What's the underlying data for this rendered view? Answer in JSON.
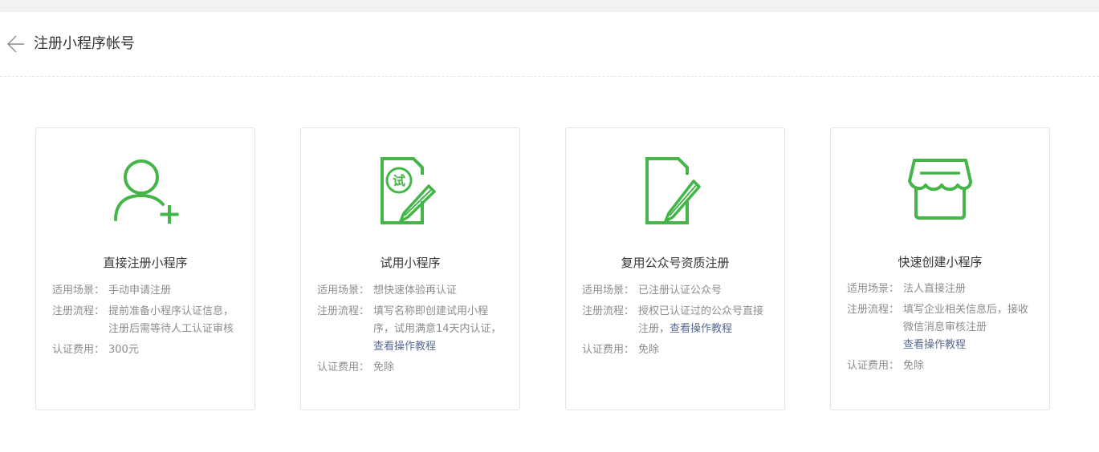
{
  "header": {
    "title": "注册小程序帐号"
  },
  "cards": [
    {
      "title": "直接注册小程序",
      "scene_label": "适用场景：",
      "scene": "手动申请注册",
      "flow_label": "注册流程：",
      "flow_line1": "提前准备小程序认证信息，",
      "flow_line2": "注册后需等待人工认证审核",
      "fee_label": "认证费用：",
      "fee": "300元",
      "icon": "user-add-icon"
    },
    {
      "title": "试用小程序",
      "scene_label": "适用场景：",
      "scene": "想快速体验再认证",
      "flow_label": "注册流程：",
      "flow_line1": "填写名称即创建试用小程",
      "flow_line2": "序，试用满意14天内认证，",
      "flow_link": "查看操作教程",
      "fee_label": "认证费用：",
      "fee": "免除",
      "icon": "trial-document-icon",
      "icon_text": "试"
    },
    {
      "title": "复用公众号资质注册",
      "scene_label": "适用场景：",
      "scene": "已注册认证公众号",
      "flow_label": "注册流程：",
      "flow_line1": "授权已认证过的公众号直接",
      "flow_line2": "注册，",
      "flow_link": "查看操作教程",
      "fee_label": "认证费用：",
      "fee": "免除",
      "icon": "document-pen-icon"
    },
    {
      "title": "快速创建小程序",
      "scene_label": "适用场景：",
      "scene": "法人直接注册",
      "flow_label": "注册流程：",
      "flow_line1": "填写企业相关信息后，接收",
      "flow_line2": "微信消息审核注册",
      "flow_link": "查看操作教程",
      "fee_label": "认证费用：",
      "fee": "免除",
      "icon": "store-icon"
    }
  ],
  "colors": {
    "accent": "#44b549",
    "link": "#576b95",
    "muted": "#8d8d8d"
  }
}
